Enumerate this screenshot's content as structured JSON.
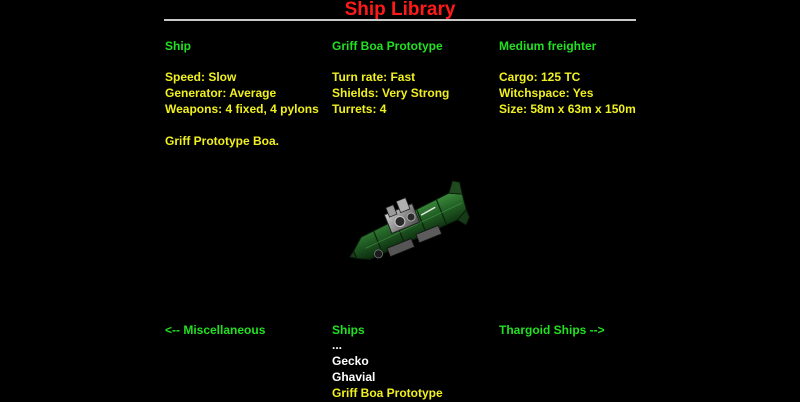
{
  "title": "Ship Library",
  "colors": {
    "title": "#ff1a1a",
    "heading": "#22e022",
    "stat": "#f0f020",
    "list": "#ffffff",
    "rule": "#c8c8c8"
  },
  "header": {
    "label": "Ship",
    "name": "Griff Boa Prototype",
    "class": "Medium freighter"
  },
  "stats": {
    "speed": "Speed: Slow",
    "generator": "Generator: Average",
    "weapons": "Weapons: 4 fixed, 4 pylons",
    "turn_rate": "Turn rate: Fast",
    "shields": "Shields: Very Strong",
    "turrets": "Turrets: 4",
    "cargo": "Cargo: 125 TC",
    "witchspace": "Witchspace: Yes",
    "size": "Size: 58m x 63m x 150m"
  },
  "description": "Griff Prototype Boa.",
  "ship_model_icon": "griff-boa-ship-model",
  "navigation": {
    "prev": "<-- Miscellaneous",
    "category": "Ships",
    "next": "Thargoid Ships -->"
  },
  "ship_list": {
    "ellipsis": "...",
    "items": [
      "Gecko",
      "Ghavial",
      "Griff Boa Prototype"
    ],
    "selected_index": 2
  }
}
